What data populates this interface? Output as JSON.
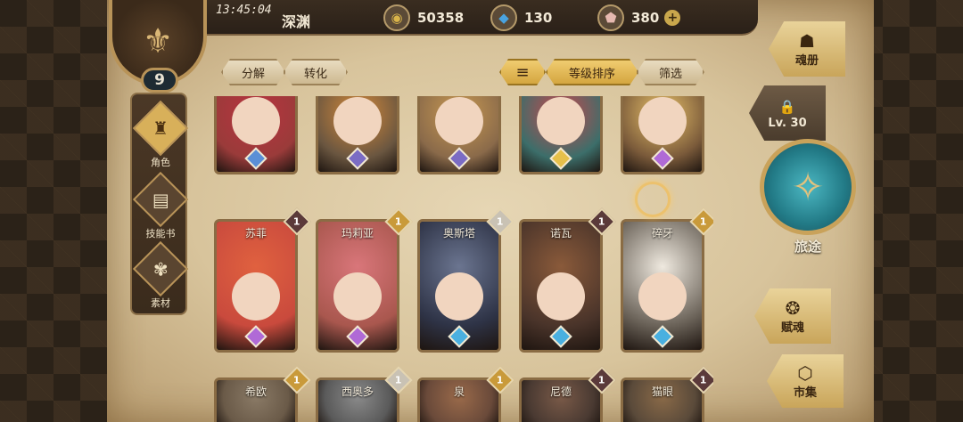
{
  "status": {
    "time": "13:45:04",
    "zone": "深渊"
  },
  "currencies": [
    {
      "icon": "gold-coin-icon",
      "value": "50358",
      "glyph": "◉",
      "color": "#d9b44a"
    },
    {
      "icon": "blue-crystal-icon",
      "value": "130",
      "glyph": "◆",
      "color": "#4aa3e0"
    },
    {
      "icon": "pink-gem-icon",
      "value": "380",
      "glyph": "⬟",
      "color": "#e6b9b0",
      "plus": "+"
    }
  ],
  "player": {
    "level": "9",
    "emblem": "⚜"
  },
  "nav": [
    {
      "label": "角色",
      "icon": "warrior-helmet-icon",
      "glyph": "♜",
      "active": true
    },
    {
      "label": "技能书",
      "icon": "skill-book-icon",
      "glyph": "▤",
      "active": false
    },
    {
      "label": "素材",
      "icon": "material-creature-icon",
      "glyph": "✾",
      "active": false
    }
  ],
  "toolbar": {
    "decompose": "分解",
    "convert": "转化",
    "sort_icon": "≡",
    "sort_by_level": "等级排序",
    "filter": "筛选"
  },
  "right_menu": {
    "soul_book": "魂册",
    "soul_book_glyph": "☗",
    "locked_level": "Lv. 30",
    "lock_glyph": "🔒",
    "journey": "旅途",
    "journey_glyph": "✧",
    "soul_grant": "赋魂",
    "soul_grant_glyph": "❂",
    "market": "市集",
    "market_glyph": "⬡"
  },
  "rows": [
    [
      {
        "name": "",
        "bg": "#9a3b3a",
        "hair": "#b8333f",
        "gem": "#5a8fd6",
        "count": ""
      },
      {
        "name": "",
        "bg": "#6a5640",
        "hair": "#d68a3a",
        "gem": "#7b6cc4",
        "count": ""
      },
      {
        "name": "",
        "bg": "#8a6a4a",
        "hair": "#c99a52",
        "gem": "#7b6cc4",
        "count": ""
      },
      {
        "name": "",
        "bg": "#3c6e6a",
        "hair": "#c9474c",
        "gem": "#e6c04a",
        "count": ""
      },
      {
        "name": "",
        "bg": "#7a5a3a",
        "hair": "#e9c26a",
        "gem": "#b06ad6",
        "count": ""
      }
    ],
    [
      {
        "name": "苏菲",
        "bg": "#c94a3d",
        "hair": "#e0613f",
        "gem": "#b06ad6",
        "count": "1",
        "badge": "#5b3a3a"
      },
      {
        "name": "玛莉亚",
        "bg": "#a9574e",
        "hair": "#d9767a",
        "gem": "#b06ad6",
        "count": "1",
        "badge": "#c99a3a"
      },
      {
        "name": "奥斯塔",
        "bg": "#2e3346",
        "hair": "#6b7590",
        "gem": "#4ab0e0",
        "count": "1",
        "badge": "#c9c2b4"
      },
      {
        "name": "诺瓦",
        "bg": "#4a342a",
        "hair": "#8a5a3a",
        "gem": "#4ab0e0",
        "count": "1",
        "badge": "#5b3a3a"
      },
      {
        "name": "碎牙",
        "bg": "#6a6258",
        "hair": "#efe9df",
        "gem": "#4ab0e0",
        "count": "1",
        "badge": "#c99a3a"
      }
    ],
    [
      {
        "name": "希欧",
        "bg": "#6a5a48",
        "hair": "#8a7a66",
        "gem": "#7b6cc4",
        "count": "1",
        "badge": "#c99a3a"
      },
      {
        "name": "西奥多",
        "bg": "#5a5a5a",
        "hair": "#8a8a8a",
        "gem": "#7b6cc4",
        "count": "1",
        "badge": "#c9c2b4"
      },
      {
        "name": "泉",
        "bg": "#6a4a3a",
        "hair": "#9a6a4a",
        "gem": "#7b6cc4",
        "count": "1",
        "badge": "#c99a3a"
      },
      {
        "name": "尼德",
        "bg": "#4a3a32",
        "hair": "#7a5a48",
        "gem": "#7b6cc4",
        "count": "1",
        "badge": "#5b3a3a"
      },
      {
        "name": "猫眼",
        "bg": "#5a4a3a",
        "hair": "#8a6a48",
        "gem": "#7b6cc4",
        "count": "1",
        "badge": "#5b3a3a"
      }
    ]
  ]
}
